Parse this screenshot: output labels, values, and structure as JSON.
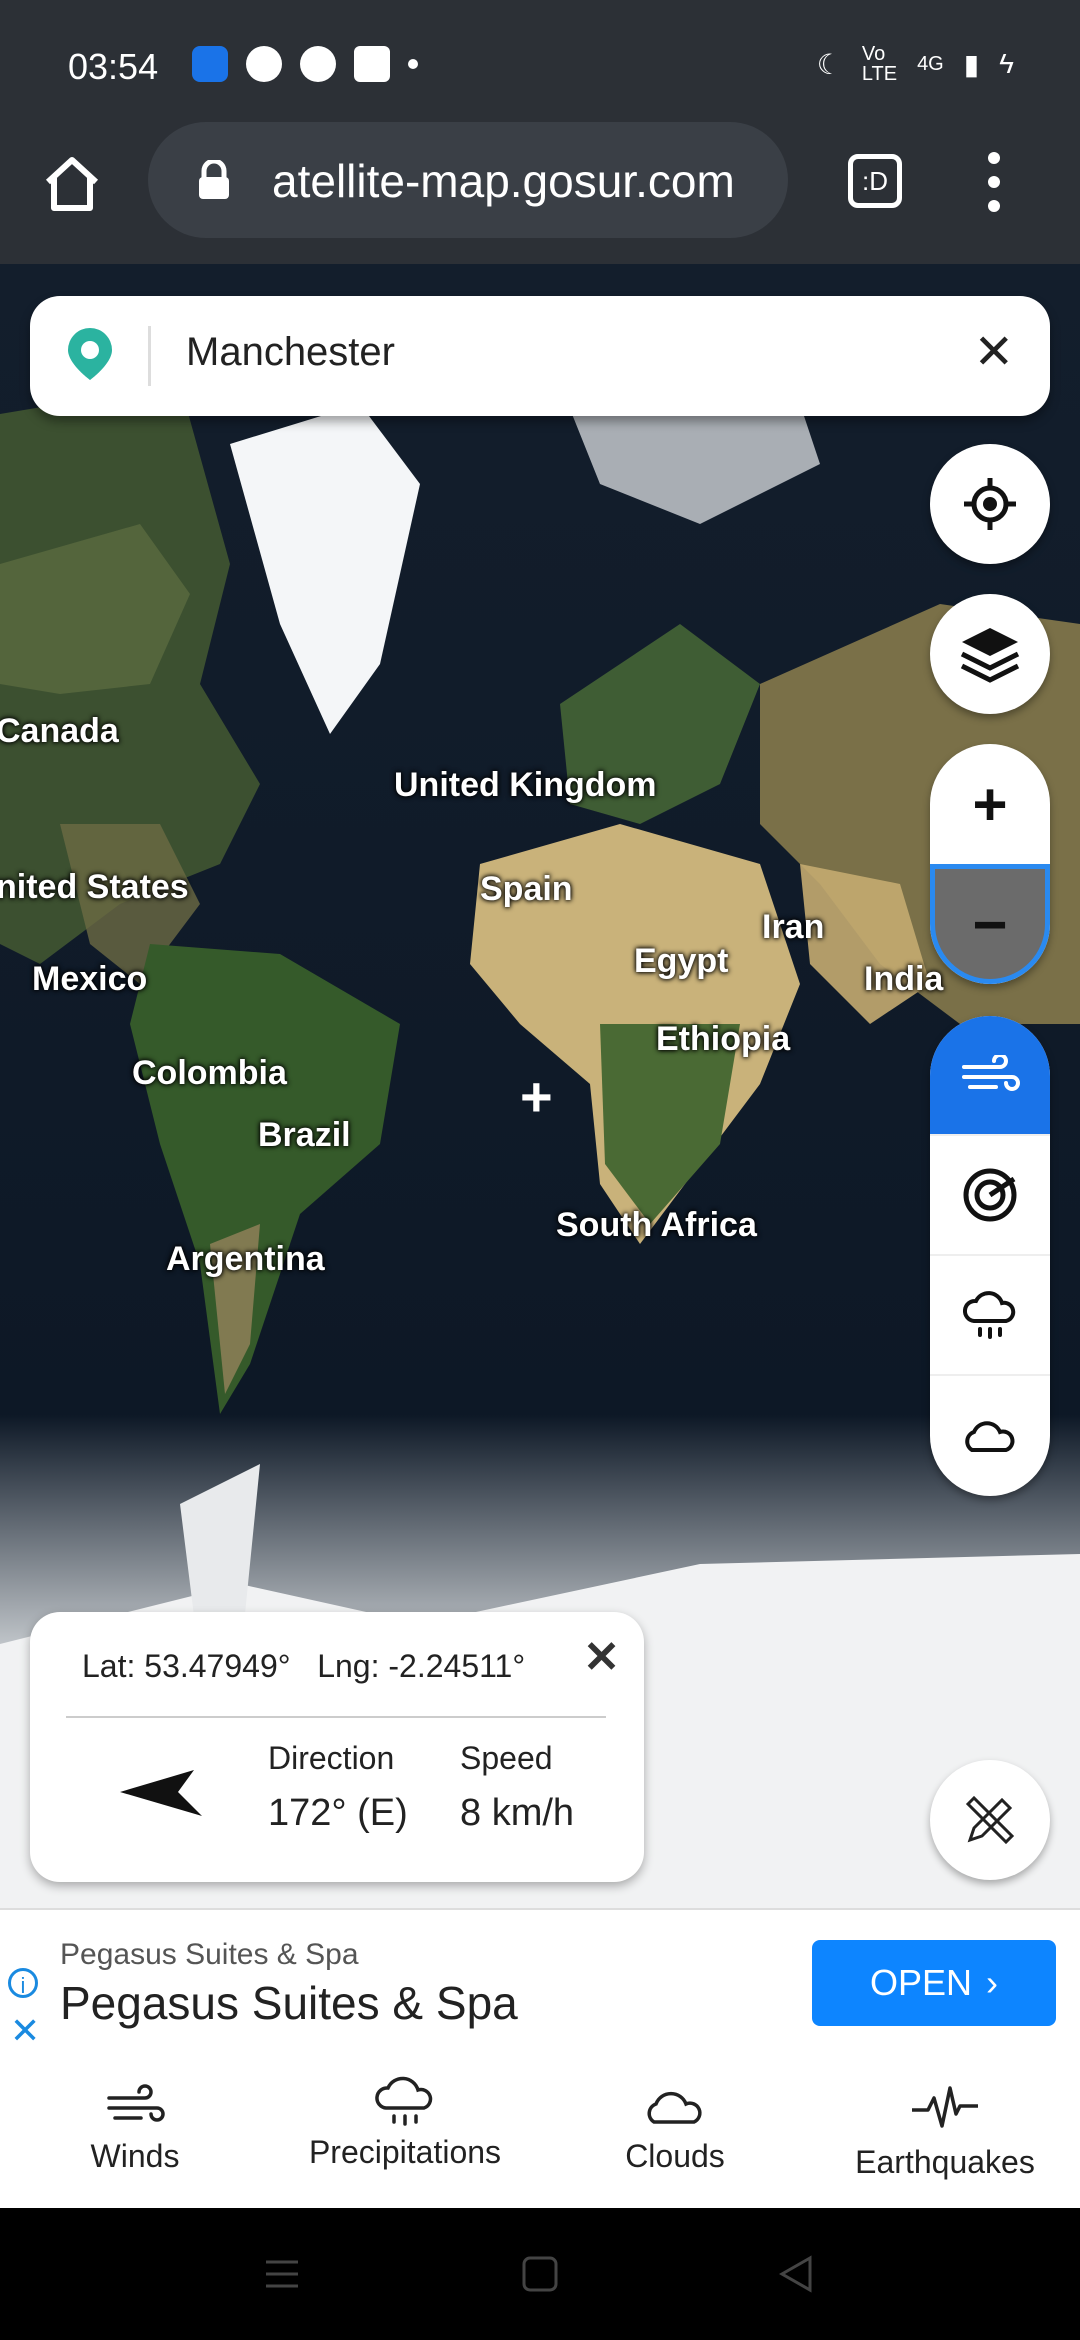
{
  "status_bar": {
    "time": "03:54",
    "network": "4G"
  },
  "browser": {
    "url": "atellite-map.gosur.com",
    "tab_icon_text": ":D"
  },
  "search": {
    "value": "Manchester"
  },
  "map": {
    "labels": [
      {
        "name": "canada",
        "text": "Canada"
      },
      {
        "name": "united-kingdom",
        "text": "United Kingdom"
      },
      {
        "name": "united-states",
        "text": "nited States"
      },
      {
        "name": "spain",
        "text": "Spain"
      },
      {
        "name": "iran",
        "text": "Iran"
      },
      {
        "name": "egypt",
        "text": "Egypt"
      },
      {
        "name": "mexico",
        "text": "Mexico"
      },
      {
        "name": "india",
        "text": "India"
      },
      {
        "name": "ethiopia",
        "text": "Ethiopia"
      },
      {
        "name": "colombia",
        "text": "Colombia"
      },
      {
        "name": "brazil",
        "text": "Brazil"
      },
      {
        "name": "south-africa",
        "text": "South Africa"
      },
      {
        "name": "argentina",
        "text": "Argentina"
      }
    ]
  },
  "info_card": {
    "lat": "Lat: 53.47949°",
    "lng": "Lng: -2.24511°",
    "direction_label": "Direction",
    "direction_value": "172° (E)",
    "speed_label": "Speed",
    "speed_value": "8 km/h"
  },
  "ad": {
    "small": "Pegasus Suites & Spa",
    "title": "Pegasus Suites & Spa",
    "button": "OPEN"
  },
  "tabs": [
    {
      "label": "Winds"
    },
    {
      "label": "Precipitations"
    },
    {
      "label": "Clouds"
    },
    {
      "label": "Earthquakes"
    }
  ],
  "colors": {
    "accent": "#1a73e8",
    "ad_button": "#0d85ff",
    "chrome": "#2c3036"
  }
}
